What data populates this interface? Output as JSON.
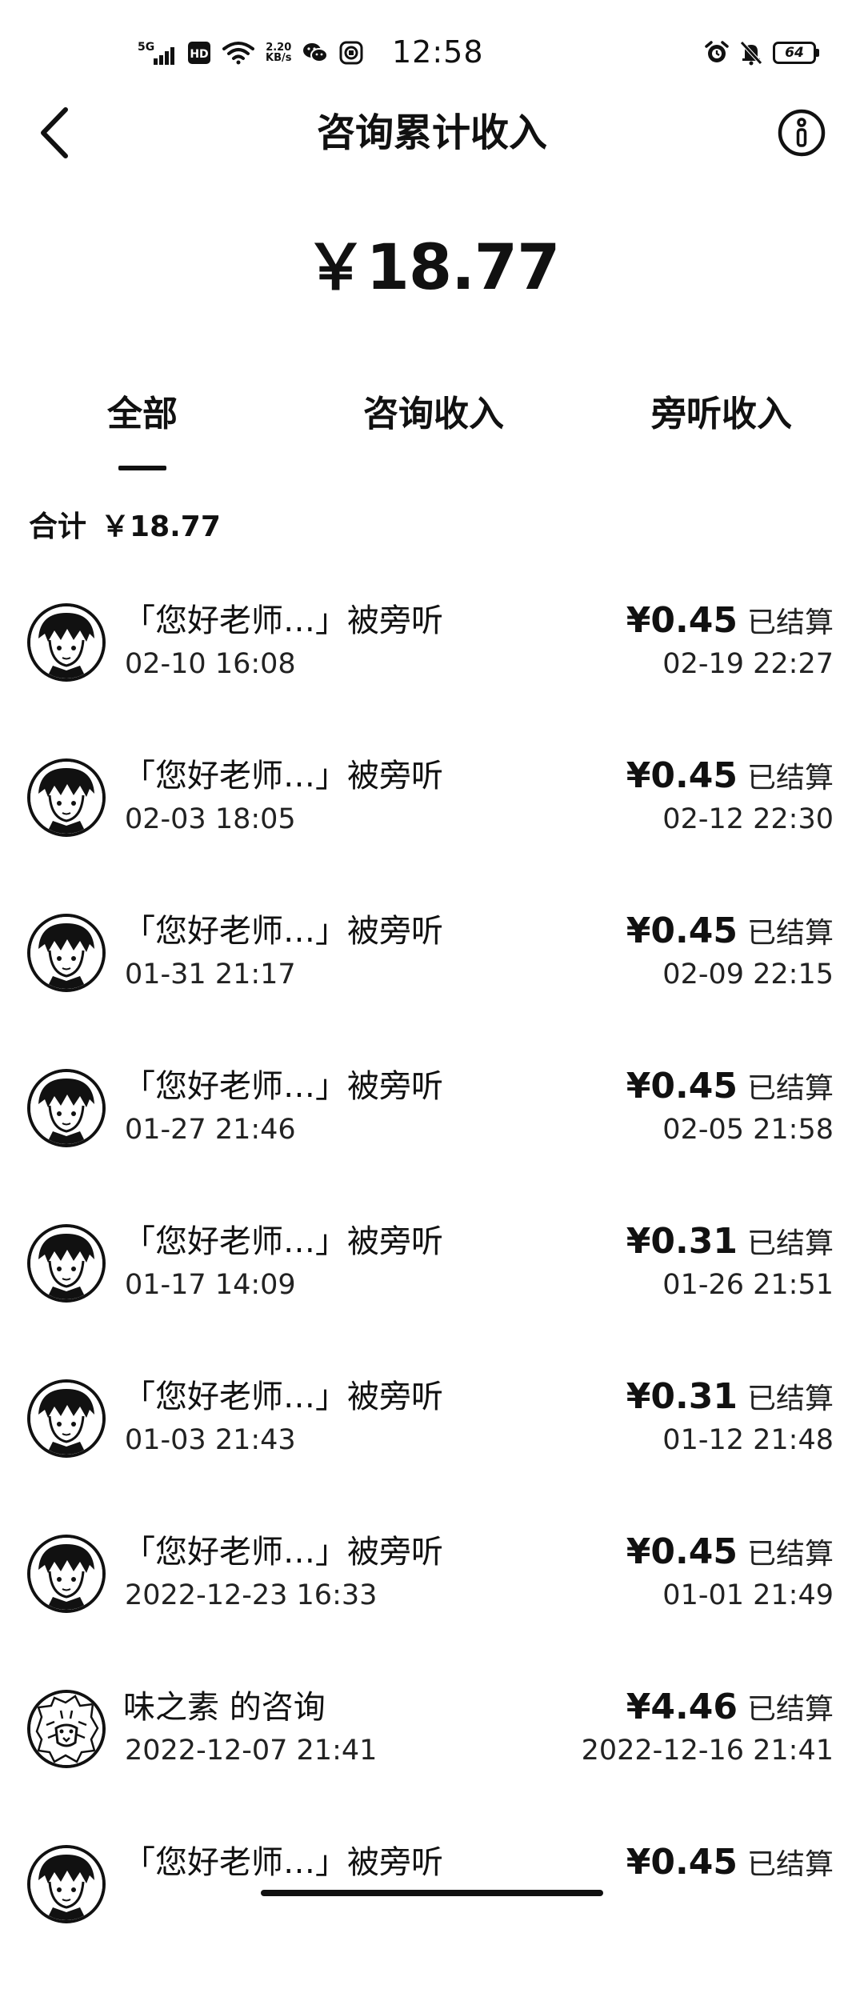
{
  "status_bar": {
    "network": "5G",
    "hd_label": "HD",
    "speed_value": "2.20",
    "speed_unit": "KB/s",
    "time": "12:58",
    "battery": "64"
  },
  "header": {
    "title": "咨询累计收入"
  },
  "total": {
    "amount": "￥18.77"
  },
  "tabs": [
    {
      "label": "全部",
      "active": true
    },
    {
      "label": "咨询收入",
      "active": false
    },
    {
      "label": "旁听收入",
      "active": false
    }
  ],
  "summary": {
    "label": "合计",
    "amount": "￥18.77"
  },
  "records": [
    {
      "title": "「您好老师…」被旁听",
      "date": "02-10 16:08",
      "amount": "¥0.45",
      "status": "已结算",
      "settled": "02-19 22:27",
      "avatar": "person"
    },
    {
      "title": "「您好老师…」被旁听",
      "date": "02-03 18:05",
      "amount": "¥0.45",
      "status": "已结算",
      "settled": "02-12 22:30",
      "avatar": "person"
    },
    {
      "title": "「您好老师…」被旁听",
      "date": "01-31 21:17",
      "amount": "¥0.45",
      "status": "已结算",
      "settled": "02-09 22:15",
      "avatar": "person"
    },
    {
      "title": "「您好老师…」被旁听",
      "date": "01-27 21:46",
      "amount": "¥0.45",
      "status": "已结算",
      "settled": "02-05 21:58",
      "avatar": "person"
    },
    {
      "title": "「您好老师…」被旁听",
      "date": "01-17 14:09",
      "amount": "¥0.31",
      "status": "已结算",
      "settled": "01-26 21:51",
      "avatar": "person"
    },
    {
      "title": "「您好老师…」被旁听",
      "date": "01-03 21:43",
      "amount": "¥0.31",
      "status": "已结算",
      "settled": "01-12 21:48",
      "avatar": "person"
    },
    {
      "title": "「您好老师…」被旁听",
      "date": "2022-12-23 16:33",
      "amount": "¥0.45",
      "status": "已结算",
      "settled": "01-01 21:49",
      "avatar": "person"
    },
    {
      "title": "味之素 的咨询",
      "date": "2022-12-07 21:41",
      "amount": "¥4.46",
      "status": "已结算",
      "settled": "2022-12-16 21:41",
      "avatar": "lion"
    },
    {
      "title": "「您好老师…」被旁听",
      "date": "",
      "amount": "¥0.45",
      "status": "已结算",
      "settled": "",
      "avatar": "person"
    }
  ]
}
